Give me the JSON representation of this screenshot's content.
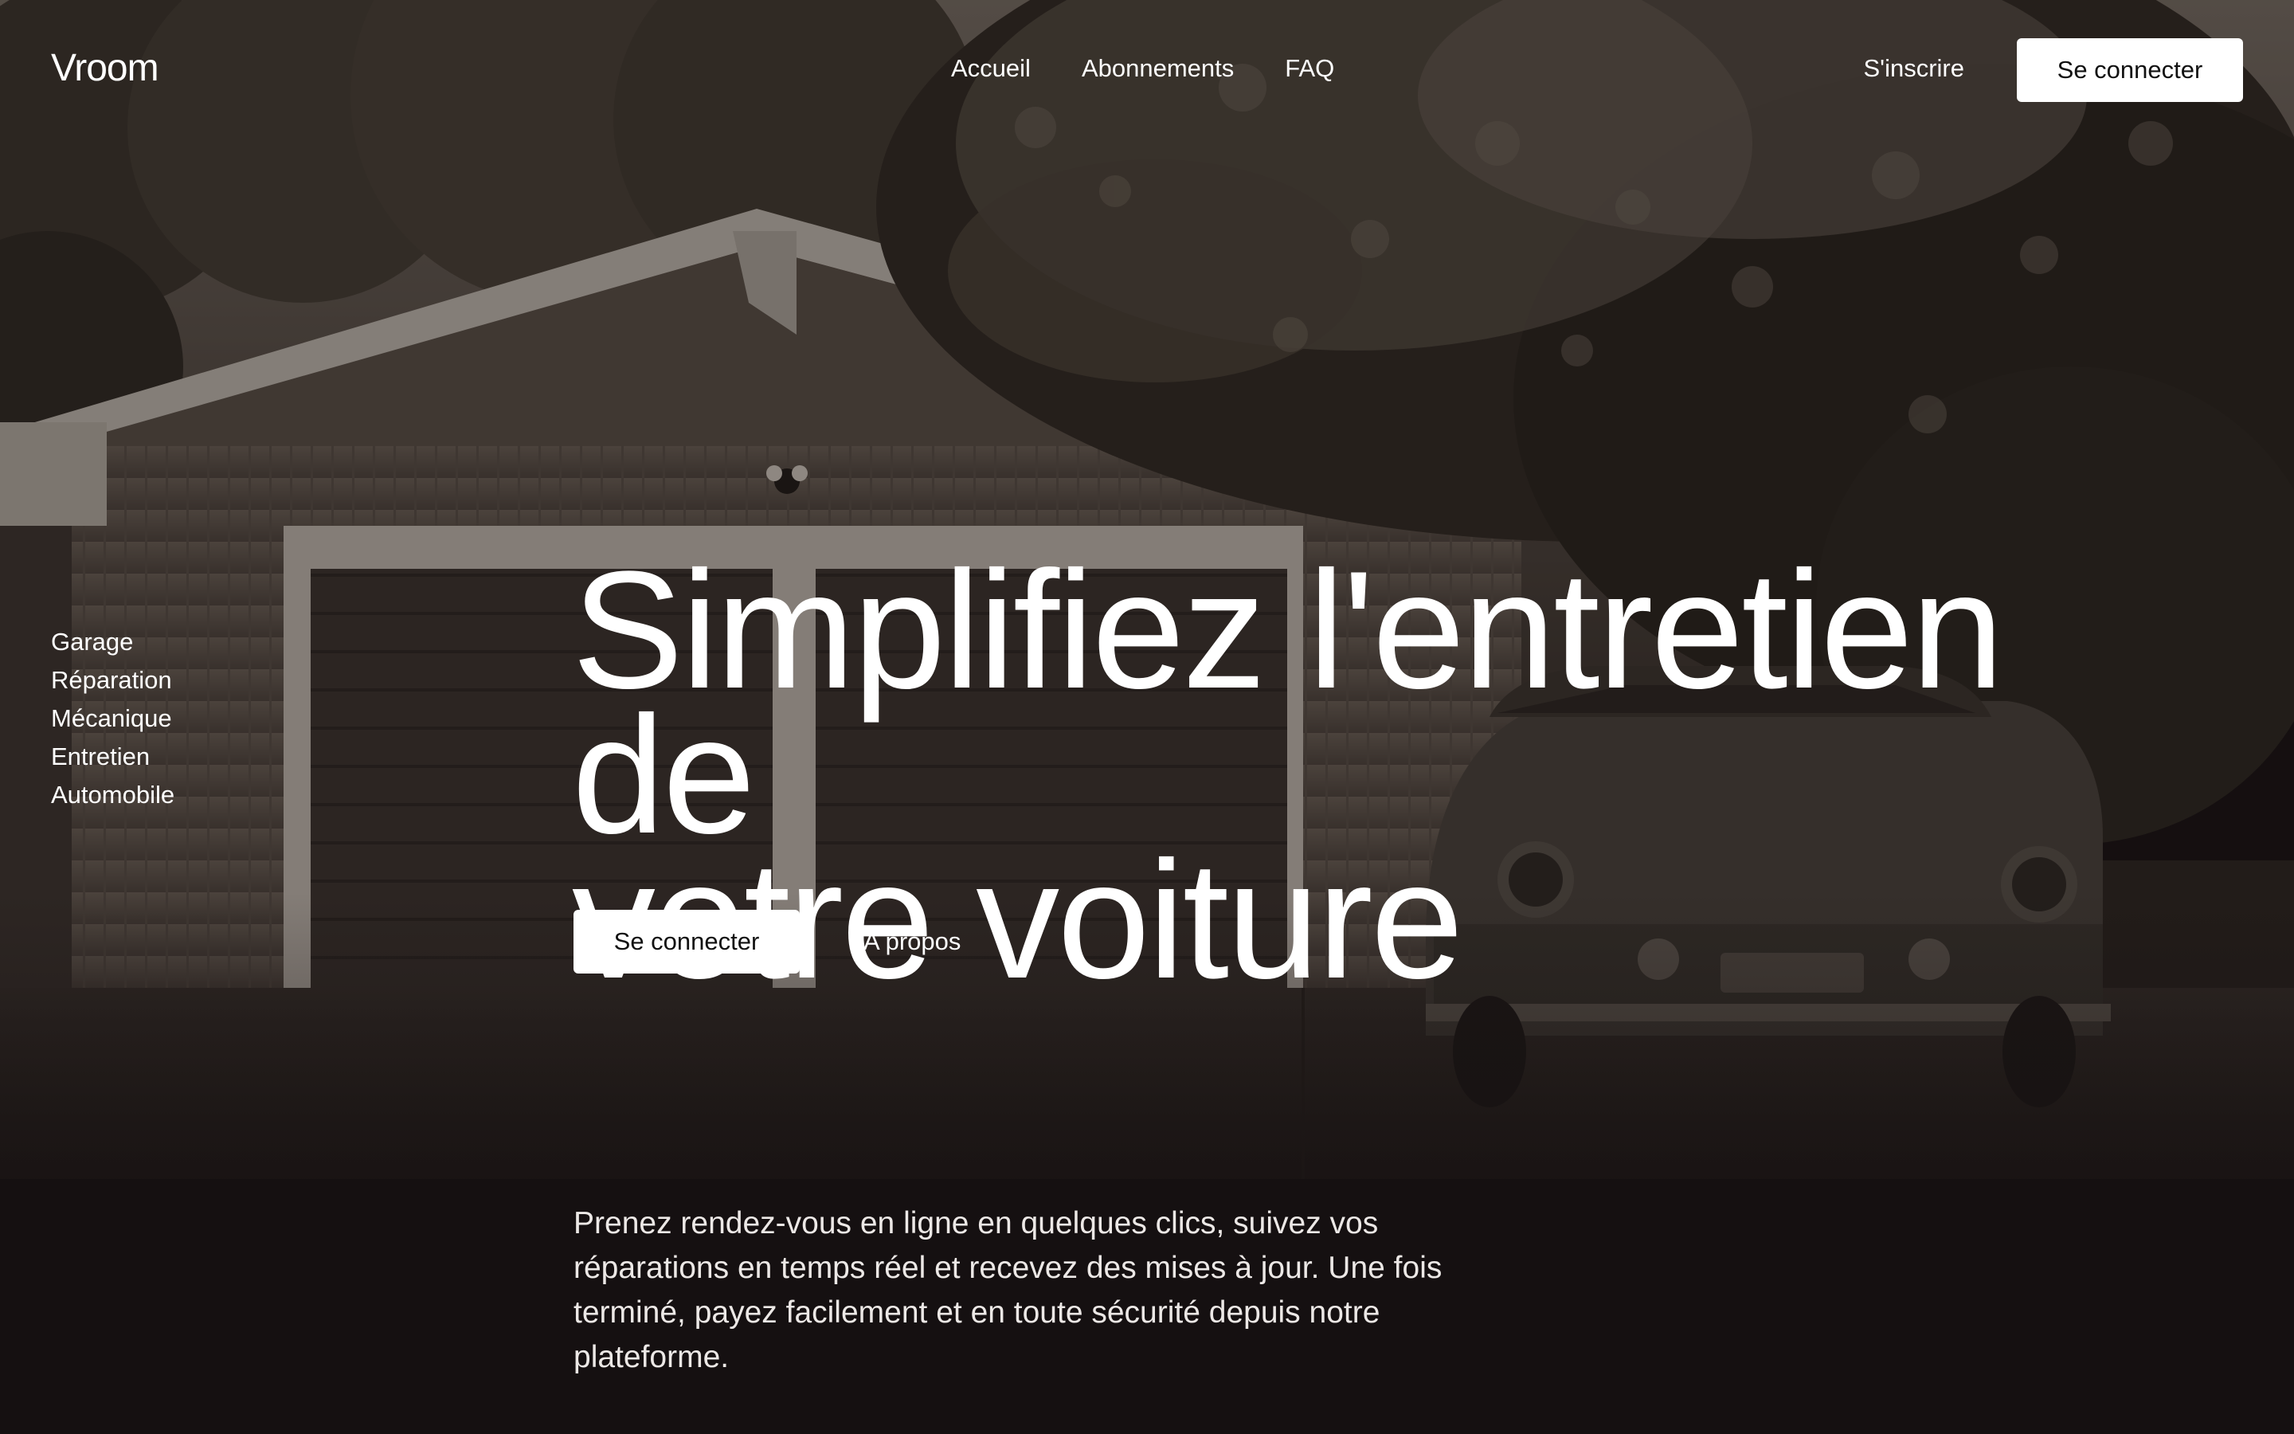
{
  "header": {
    "logo": "Vroom",
    "nav": [
      "Accueil",
      "Abonnements",
      "FAQ"
    ],
    "signup_label": "S'inscrire",
    "login_label": "Se connecter"
  },
  "sidebar": {
    "tags": [
      "Garage",
      "Réparation",
      "Mécanique",
      "Entretien",
      "Automobile"
    ]
  },
  "hero": {
    "headline_line1": "Simplifiez l'entretien de",
    "headline_line2": "votre voiture",
    "primary_button": "Se connecter",
    "secondary_link": "A propos",
    "description": "Prenez rendez-vous en ligne en quelques clics, suivez vos réparations en temps réel et recevez des mises à jour. Une fois terminé, payez facilement et en toute sécurité depuis notre plateforme.",
    "background": {
      "subject": "garage-with-classic-car-under-trees",
      "tone": "dark sepia",
      "base_color": "#151011"
    }
  },
  "colors": {
    "background": "#151011",
    "text": "#ffffff",
    "button_bg": "#ffffff",
    "button_text": "#111111"
  }
}
